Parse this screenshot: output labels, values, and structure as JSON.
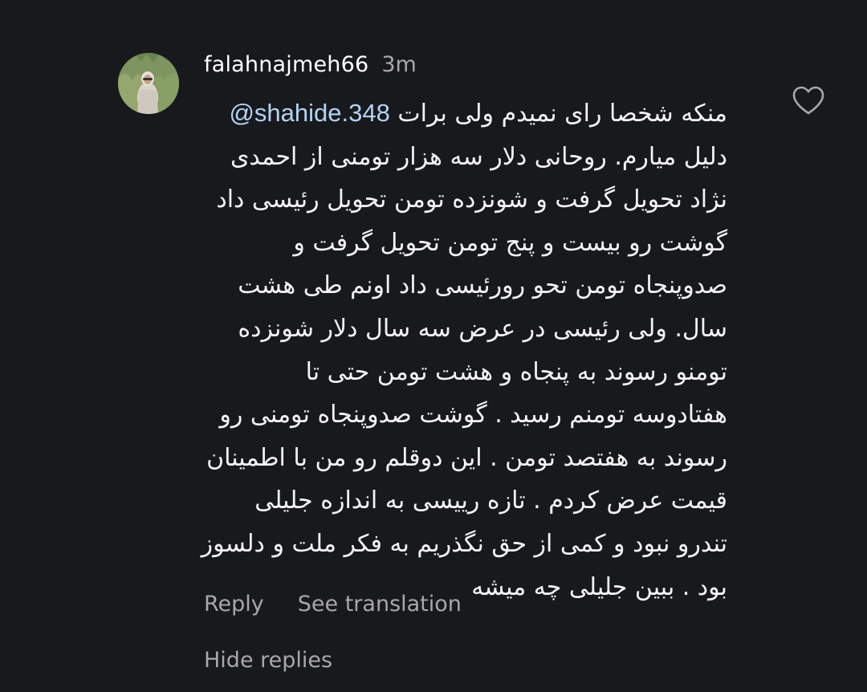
{
  "comment": {
    "username": "falahnajmeh66",
    "timestamp": "3m",
    "mention": "@shahide.348",
    "first_line_text": "منکه شخصا رای نمیدم ولی برات",
    "lines": [
      "دلیل میارم. روحانی دلار سه هزار تومنی از احمدی",
      "نژاد تحویل گرفت و شونزده تومن تحویل رئیسی داد",
      "گوشت رو بیست و پنج تومن  تحویل گرفت و",
      "صدوپنجاه تومن تحو رورئیسی داد  اونم طی هشت",
      "سال. ولی رئیسی در عرض سه سال  دلار شونزده",
      "تومنو رسوند به پنجاه و هشت تومن حتی تا",
      "هفتادوسه تومنم رسید . گوشت صدوپنجاه تومنی رو",
      "رسوند به هفتصد تومن . این دوقلم رو من  با اطمینان",
      "قیمت عرض کردم . تازه رییسی به اندازه جلیلی",
      "تندرو نبود  و کمی از حق نگذریم به فکر ملت و دلسوز",
      "بود . ببین جلیلی چه میشه"
    ],
    "reply_label": "Reply",
    "see_translation_label": "See translation",
    "hide_replies_label": "Hide replies",
    "like_icon": "heart-outline-icon"
  },
  "colors": {
    "background": "#17191c",
    "text_primary": "#f3f3f3",
    "text_secondary": "#a8a8a8",
    "mention": "#b4d3f5"
  }
}
